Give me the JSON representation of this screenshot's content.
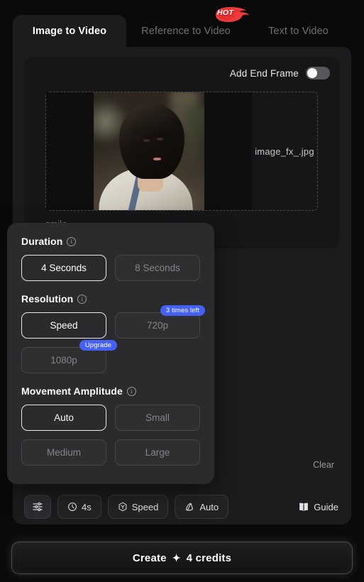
{
  "tabs": [
    {
      "label": "Image to Video",
      "active": true
    },
    {
      "label": "Reference to Video",
      "active": false,
      "badge": "HOT"
    },
    {
      "label": "Text to Video",
      "active": false
    }
  ],
  "upload": {
    "end_frame_label": "Add End Frame",
    "end_frame_on": false,
    "filename": "image_fx_.jpg",
    "prompt_hint": "smile"
  },
  "settings_popup": {
    "groups": [
      {
        "title": "Duration",
        "name": "duration",
        "options": [
          {
            "label": "4 Seconds",
            "selected": true
          },
          {
            "label": "8 Seconds",
            "selected": false
          }
        ]
      },
      {
        "title": "Resolution",
        "name": "resolution",
        "options": [
          {
            "label": "Speed",
            "selected": true
          },
          {
            "label": "720p",
            "selected": false,
            "badge": "3 times left"
          },
          {
            "label": "1080p",
            "selected": false,
            "badge": "Upgrade"
          }
        ]
      },
      {
        "title": "Movement Amplitude",
        "name": "movement-amplitude",
        "options": [
          {
            "label": "Auto",
            "selected": true
          },
          {
            "label": "Small",
            "selected": false
          },
          {
            "label": "Medium",
            "selected": false
          },
          {
            "label": "Large",
            "selected": false
          }
        ]
      }
    ]
  },
  "clear_label": "Clear",
  "chipbar": {
    "settings_icon": "sliders-icon",
    "chips": [
      {
        "icon": "clock-icon",
        "label": "4s"
      },
      {
        "icon": "hexagon-speed-icon",
        "label": "Speed"
      },
      {
        "icon": "motion-cube-icon",
        "label": "Auto"
      }
    ],
    "guide_label": "Guide",
    "guide_icon": "book-icon"
  },
  "create": {
    "label": "Create",
    "spark": "✦",
    "credits": "4 credits"
  },
  "colors": {
    "accent_blue": "#4560f5",
    "hot_red": "#ef3b3b",
    "card_bg": "#1c1c1e",
    "popup_bg": "#2b2b2d"
  }
}
